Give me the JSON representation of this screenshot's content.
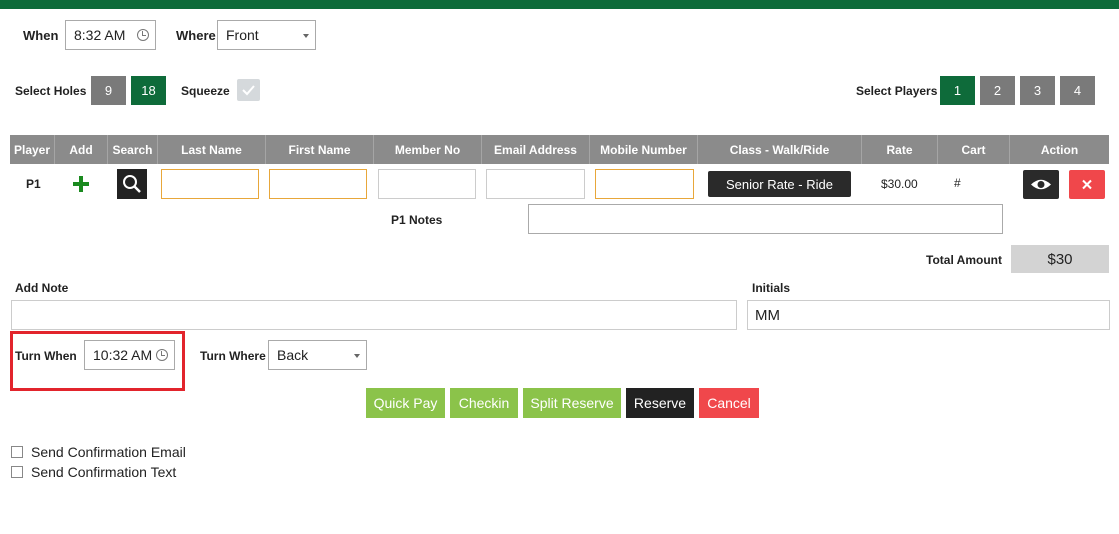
{
  "header": {
    "when_label": "When",
    "when_value": "8:32 AM",
    "where_label": "Where",
    "where_value": "Front"
  },
  "holes": {
    "label": "Select Holes",
    "options": [
      "9",
      "18"
    ],
    "selected": "18",
    "squeeze_label": "Squeeze",
    "squeeze_checked": true
  },
  "players_select": {
    "label": "Select Players",
    "options": [
      "1",
      "2",
      "3",
      "4"
    ],
    "selected": "1"
  },
  "table": {
    "columns": [
      "Player",
      "Add",
      "Search",
      "Last Name",
      "First Name",
      "Member No",
      "Email Address",
      "Mobile Number",
      "Class - Walk/Ride",
      "Rate",
      "Cart",
      "Action"
    ],
    "rows": [
      {
        "player": "P1",
        "last_name": "",
        "first_name": "",
        "member_no": "",
        "email": "",
        "mobile": "",
        "class_button": "Senior Rate - Ride",
        "rate": "$30.00",
        "cart": "#",
        "notes_label": "P1 Notes",
        "notes_value": ""
      }
    ]
  },
  "total": {
    "label": "Total Amount",
    "value": "$30"
  },
  "note": {
    "label": "Add Note",
    "value": ""
  },
  "initials": {
    "label": "Initials",
    "value": "MM"
  },
  "turn": {
    "when_label": "Turn When",
    "when_value": "10:32 AM",
    "where_label": "Turn Where",
    "where_value": "Back"
  },
  "actions": {
    "quick_pay": "Quick Pay",
    "checkin": "Checkin",
    "split_reserve": "Split Reserve",
    "reserve": "Reserve",
    "cancel": "Cancel"
  },
  "confirmations": {
    "email_label": "Send Confirmation Email",
    "text_label": "Send Confirmation Text"
  },
  "colors": {
    "brand_green": "#0e6b3a",
    "light_green": "#8bc34a",
    "cancel_red": "#f0474b",
    "highlight_red": "#e2242c"
  },
  "icons": [
    "clock-icon",
    "dropdown-caret-icon",
    "plus-icon",
    "search-icon",
    "eye-icon",
    "close-icon",
    "check-icon"
  ]
}
